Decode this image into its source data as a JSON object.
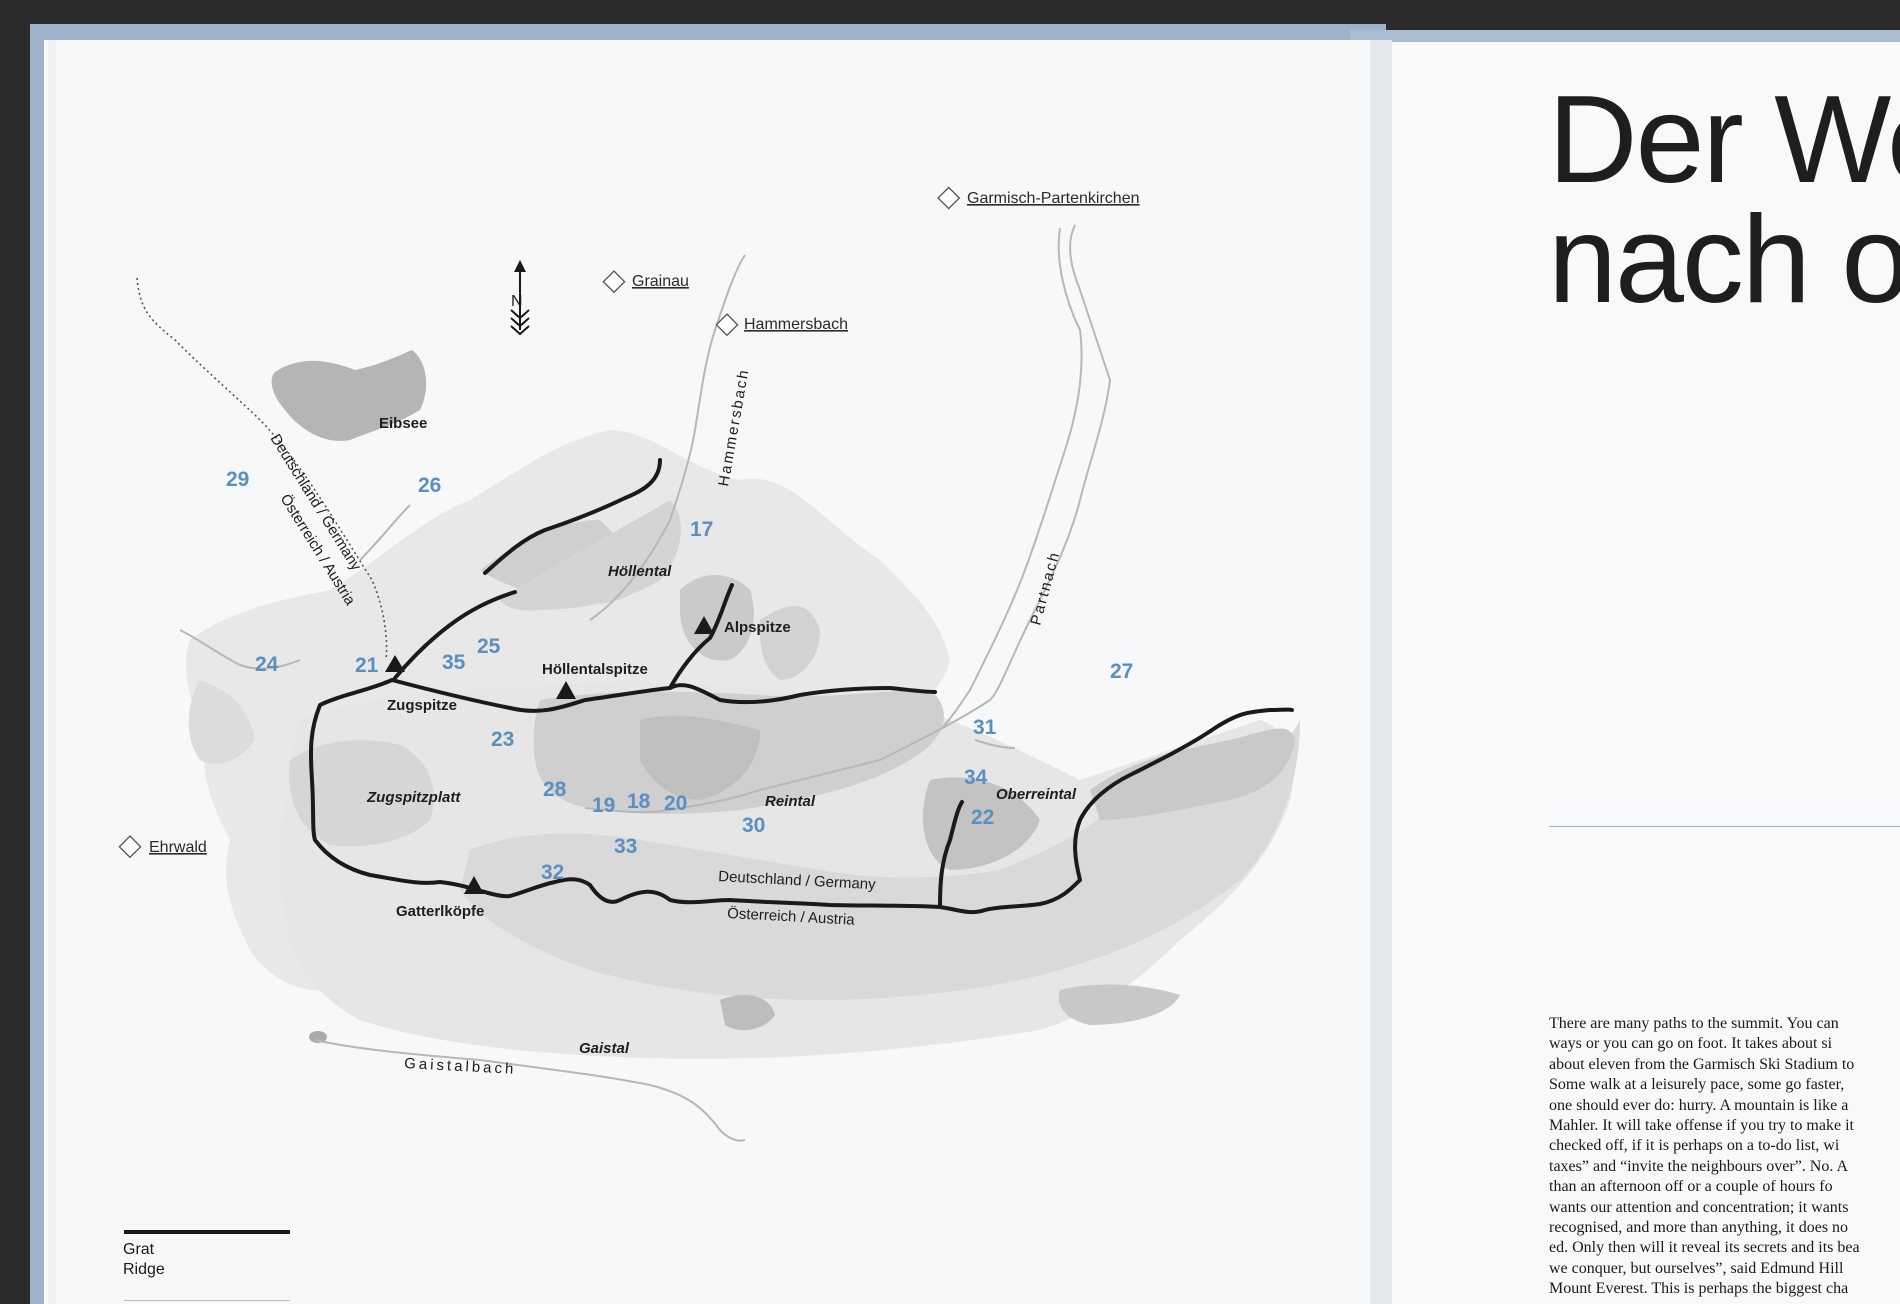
{
  "map": {
    "places": {
      "garmisch": "Garmisch-Partenkirchen",
      "grainau": "Grainau",
      "hammersbach_town": "Hammersbach",
      "ehrwald": "Ehrwald"
    },
    "water": {
      "eibsee": "Eibsee",
      "hammersbach_stream": "Hammersbach",
      "partnach": "Partnach",
      "gaistalbach": "Gaistalbach"
    },
    "peaks": {
      "zugspitze": "Zugspitze",
      "hoellentalspitze": "Höllentalspitze",
      "alpspitze": "Alpspitze",
      "gatterlkoepfe": "Gatterlköpfe"
    },
    "valleys": {
      "hoellental": "Höllental",
      "zugspitzplatt": "Zugspitzplatt",
      "reintal": "Reintal",
      "oberreintal": "Oberreintal",
      "gaistal": "Gaistal"
    },
    "borders": {
      "de_upper": "Deutschland / Germany",
      "at_upper": "Österreich / Austria",
      "de_lower": "Deutschland / Germany",
      "at_lower": "Österreich / Austria"
    },
    "compass": "N",
    "markers": [
      "29",
      "26",
      "17",
      "24",
      "21",
      "35",
      "25",
      "27",
      "23",
      "31",
      "28",
      "19",
      "18",
      "20",
      "34",
      "22",
      "30",
      "33",
      "32"
    ]
  },
  "legend": {
    "line1": "Grat",
    "line2": "Ridge"
  },
  "right_page": {
    "title_line1": "Der We",
    "title_line2": "nach ob",
    "body_lines": [
      "There are many paths to the summit. You can",
      "ways or you can go on foot. It takes about si",
      "about eleven from the Garmisch Ski Stadium to",
      "Some walk at a leisurely pace, some go faster,",
      "one should ever do: hurry. A mountain is like a",
      "Mahler. It will take offense if you try to make it",
      "checked off, if it is perhaps on a to-do list, wi",
      "taxes” and “invite the neighbours over”. No. A",
      "than an afternoon off or a couple of hours fo",
      "wants our attention and concentration; it wants",
      "recognised, and more than anything, it does no",
      "ed. Only then will it reveal its secrets and its bea",
      "we conquer, but ourselves”, said Edmund Hill",
      "Mount Everest. This is perhaps the biggest cha"
    ]
  },
  "colors": {
    "page": "#f7f8fa",
    "marker": "#5b8fbf",
    "ridge": "#1a1a1a",
    "terrain_light": "#e2e2e2",
    "terrain_dark": "#c8c8c8",
    "river": "#b8b8b8"
  }
}
